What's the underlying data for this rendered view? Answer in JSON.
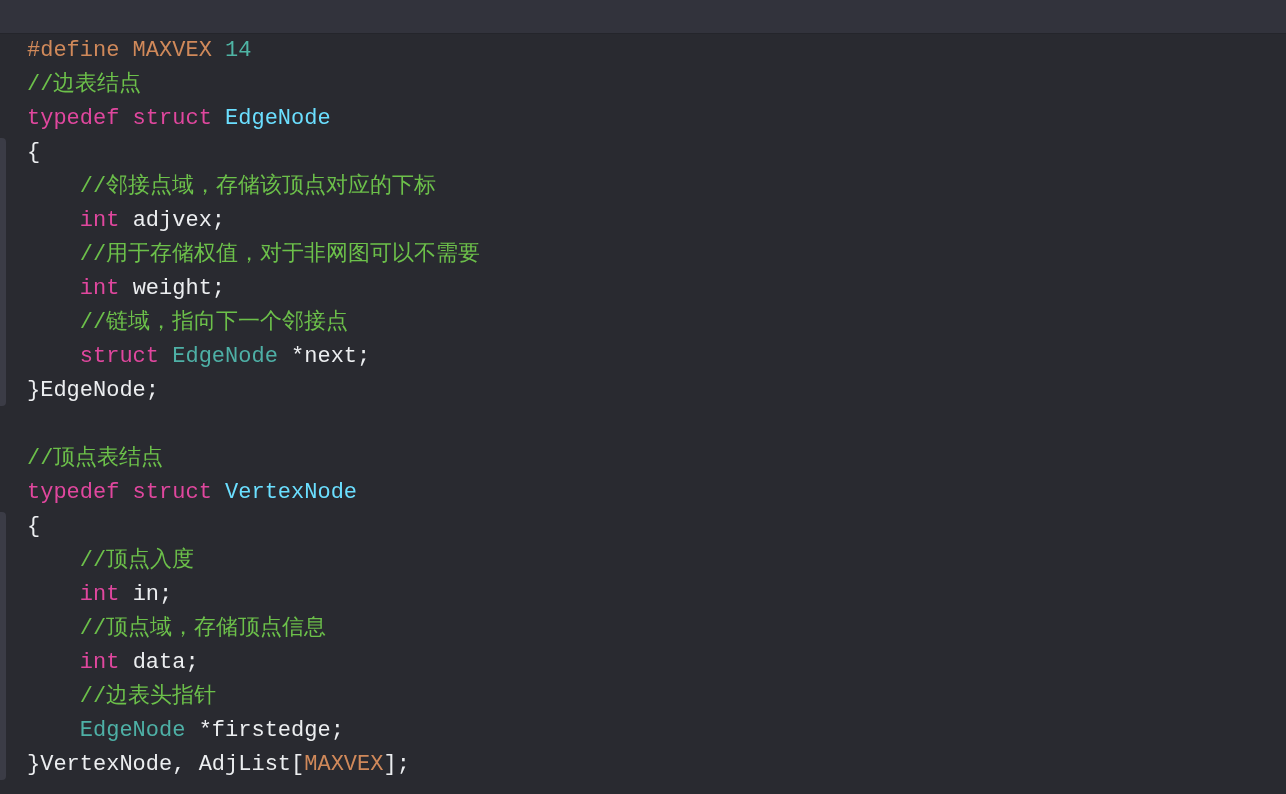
{
  "editor": {
    "items": [
      {
        "kind": "line",
        "tokens": [
          {
            "kind": "macro",
            "text": "#define MAXVEX "
          },
          {
            "kind": "number",
            "text": "14"
          }
        ]
      },
      {
        "kind": "line",
        "tokens": [
          {
            "kind": "comment",
            "text": "//边表结点"
          }
        ]
      },
      {
        "kind": "line",
        "tokens": [
          {
            "kind": "keyword",
            "text": "typedef struct "
          },
          {
            "kind": "type_decl",
            "text": "EdgeNode"
          }
        ]
      },
      {
        "kind": "block",
        "children": [
          {
            "kind": "line",
            "tokens": [
              {
                "kind": "plain",
                "text": "{"
              }
            ]
          },
          {
            "kind": "line",
            "tokens": [
              {
                "kind": "comment",
                "text": "    //邻接点域，存储该顶点对应的下标"
              }
            ]
          },
          {
            "kind": "line",
            "tokens": [
              {
                "kind": "keyword",
                "text": "    int "
              },
              {
                "kind": "plain",
                "text": "adjvex;"
              }
            ]
          },
          {
            "kind": "line",
            "tokens": [
              {
                "kind": "comment",
                "text": "    //用于存储权值，对于非网图可以不需要"
              }
            ]
          },
          {
            "kind": "line",
            "tokens": [
              {
                "kind": "keyword",
                "text": "    int "
              },
              {
                "kind": "plain",
                "text": "weight;"
              }
            ]
          },
          {
            "kind": "line",
            "tokens": [
              {
                "kind": "comment",
                "text": "    //链域，指向下一个邻接点"
              }
            ]
          },
          {
            "kind": "line",
            "tokens": [
              {
                "kind": "keyword",
                "text": "    struct "
              },
              {
                "kind": "type_ref",
                "text": "EdgeNode "
              },
              {
                "kind": "plain",
                "text": "*next;"
              }
            ]
          },
          {
            "kind": "line",
            "tokens": [
              {
                "kind": "plain",
                "text": "}EdgeNode;"
              }
            ]
          }
        ]
      },
      {
        "kind": "blank"
      },
      {
        "kind": "line",
        "tokens": [
          {
            "kind": "comment",
            "text": "//顶点表结点"
          }
        ]
      },
      {
        "kind": "line",
        "tokens": [
          {
            "kind": "keyword",
            "text": "typedef struct "
          },
          {
            "kind": "type_decl",
            "text": "VertexNode"
          }
        ]
      },
      {
        "kind": "block",
        "children": [
          {
            "kind": "line",
            "tokens": [
              {
                "kind": "plain",
                "text": "{"
              }
            ]
          },
          {
            "kind": "line",
            "tokens": [
              {
                "kind": "comment",
                "text": "    //顶点入度"
              }
            ]
          },
          {
            "kind": "line",
            "tokens": [
              {
                "kind": "keyword",
                "text": "    int "
              },
              {
                "kind": "plain",
                "text": "in;"
              }
            ]
          },
          {
            "kind": "line",
            "tokens": [
              {
                "kind": "comment",
                "text": "    //顶点域，存储顶点信息"
              }
            ]
          },
          {
            "kind": "line",
            "tokens": [
              {
                "kind": "keyword",
                "text": "    int "
              },
              {
                "kind": "plain",
                "text": "data;"
              }
            ]
          },
          {
            "kind": "line",
            "tokens": [
              {
                "kind": "comment",
                "text": "    //边表头指针"
              }
            ]
          },
          {
            "kind": "line",
            "tokens": [
              {
                "kind": "type_ref",
                "text": "    EdgeNode "
              },
              {
                "kind": "plain",
                "text": "*firstedge;"
              }
            ]
          },
          {
            "kind": "line",
            "tokens": [
              {
                "kind": "plain",
                "text": "}VertexNode, AdjList["
              },
              {
                "kind": "macro",
                "text": "MAXVEX"
              },
              {
                "kind": "plain",
                "text": "];"
              }
            ]
          }
        ]
      }
    ]
  }
}
